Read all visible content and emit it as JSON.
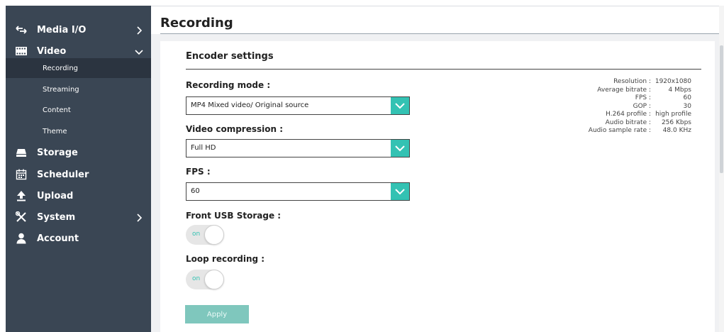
{
  "title": "Recording",
  "colors": {
    "sidebar": "#3a4654",
    "sidebar_active": "#2b3440",
    "accent": "#33c2b3",
    "apply": "#7fc7bd"
  },
  "sidebar": {
    "items": [
      {
        "label": "Media I/O",
        "icon": "swap-arrows-icon",
        "chevron": "right"
      },
      {
        "label": "Video",
        "icon": "film-strip-icon",
        "chevron": "down"
      },
      {
        "label": "Storage",
        "icon": "drive-icon"
      },
      {
        "label": "Scheduler",
        "icon": "calendar-icon"
      },
      {
        "label": "Upload",
        "icon": "upload-arrow-icon"
      },
      {
        "label": "System",
        "icon": "tools-icon",
        "chevron": "right"
      },
      {
        "label": "Account",
        "icon": "user-icon"
      }
    ],
    "video_sub": [
      {
        "label": "Recording",
        "active": true
      },
      {
        "label": "Streaming"
      },
      {
        "label": "Content"
      },
      {
        "label": "Theme"
      }
    ]
  },
  "encoder": {
    "section_title": "Encoder settings",
    "recording_mode": {
      "label": "Recording mode :",
      "value": "MP4 Mixed video/ Original source"
    },
    "video_compression": {
      "label": "Video compression :",
      "value": "Full HD"
    },
    "fps": {
      "label": "FPS :",
      "value": "60"
    },
    "front_usb": {
      "label": "Front USB Storage :",
      "state": "on"
    },
    "loop_recording": {
      "label": "Loop recording :",
      "state": "on"
    },
    "apply_label": "Apply"
  },
  "info": [
    {
      "key": "Resolution :",
      "value": "1920x1080"
    },
    {
      "key": "Average bitrate :",
      "value": "4 Mbps"
    },
    {
      "key": "FPS :",
      "value": "60"
    },
    {
      "key": "GOP :",
      "value": "30"
    },
    {
      "key": "H.264 profile :",
      "value": "high profile"
    },
    {
      "key": "Audio bitrate :",
      "value": "256 Kbps"
    },
    {
      "key": "Audio sample rate :",
      "value": "48.0 KHz"
    }
  ]
}
